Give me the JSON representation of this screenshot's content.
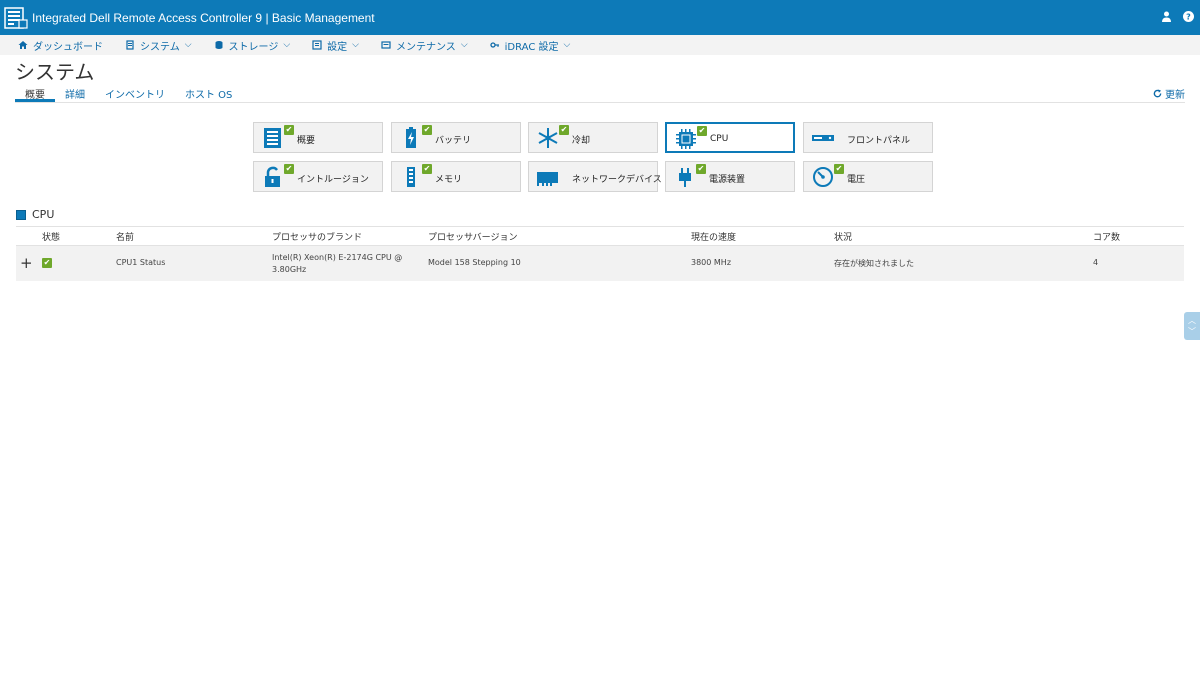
{
  "header": {
    "title": "Integrated Dell Remote Access Controller 9 | Basic Management",
    "icons": [
      "user-icon",
      "help-icon"
    ],
    "colors": {
      "bar": "#0d7ab8",
      "check": "#6fa82b"
    }
  },
  "nav": [
    {
      "label": "ダッシュボード",
      "icon": "home-icon"
    },
    {
      "label": "システム",
      "icon": "server-icon",
      "chev": "⌵"
    },
    {
      "label": "ストレージ",
      "icon": "storage-icon",
      "chev": "⌵"
    },
    {
      "label": "設定",
      "icon": "settings-icon",
      "chev": "⌵"
    },
    {
      "label": "メンテナンス",
      "icon": "maintenance-icon",
      "chev": "⌵"
    },
    {
      "label": "iDRAC 設定",
      "icon": "key-icon",
      "chev": "⌵"
    }
  ],
  "page": {
    "title": "システム",
    "tabs": [
      "概要",
      "詳細",
      "インベントリ",
      "ホスト OS"
    ],
    "refresh_label": "更新"
  },
  "tiles": [
    {
      "label": "概要",
      "icon": "summary-icon"
    },
    {
      "label": "バッテリ",
      "icon": "battery-icon"
    },
    {
      "label": "冷却",
      "icon": "cooling-icon"
    },
    {
      "label": "CPU",
      "icon": "cpu-icon"
    },
    {
      "label": "フロントパネル",
      "icon": "front-panel-icon"
    },
    {
      "label": "イントルージョン",
      "icon": "intrusion-icon"
    },
    {
      "label": "メモリ",
      "icon": "memory-icon"
    },
    {
      "label": "ネットワークデバイス",
      "icon": "network-device-icon"
    },
    {
      "label": "電源装置",
      "icon": "power-supply-icon"
    },
    {
      "label": "電圧",
      "icon": "voltage-icon"
    }
  ],
  "section": {
    "title": "CPU",
    "columns": [
      "状態",
      "名前",
      "プロセッサのブランド",
      "プロセッサバージョン",
      "現在の速度",
      "状況",
      "コア数"
    ],
    "rows": [
      {
        "name": "CPU1 Status",
        "brand": "Intel(R) Xeon(R) E-2174G CPU @ 3.80GHz",
        "version": "Model 158 Stepping 10",
        "speed": "3800 MHz",
        "status": "存在が検知されました",
        "cores": "4"
      }
    ]
  }
}
